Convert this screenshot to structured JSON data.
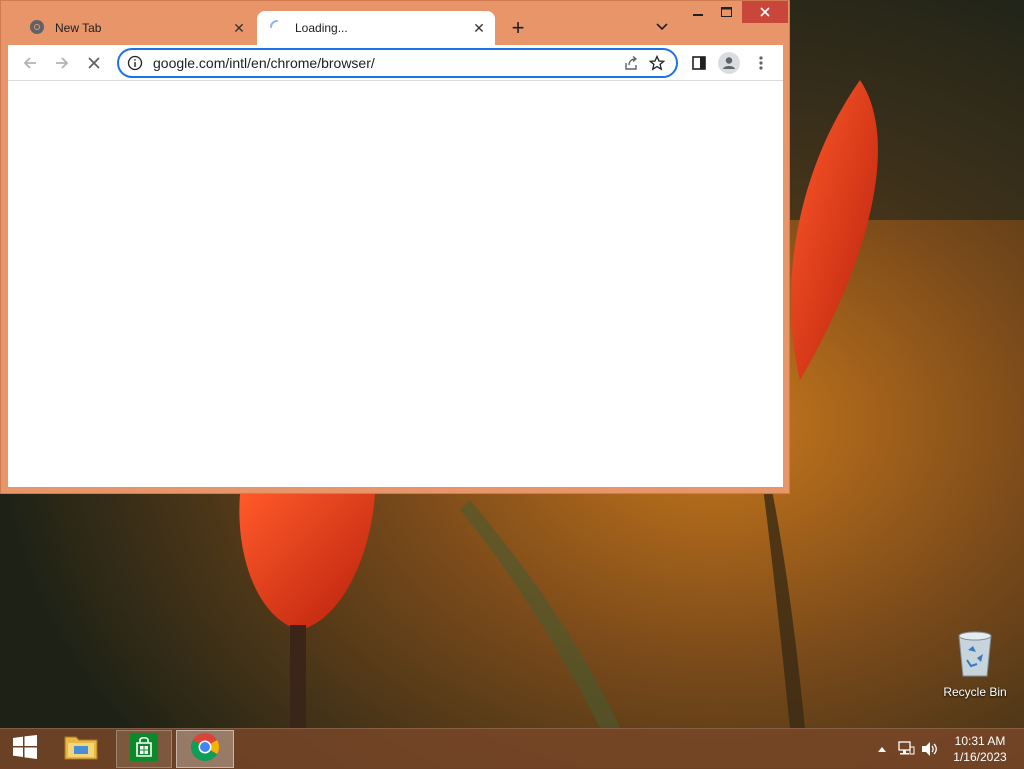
{
  "browser": {
    "tabs": [
      {
        "title": "New Tab"
      },
      {
        "title": "Loading..."
      }
    ],
    "url": "google.com/intl/en/chrome/browser/",
    "colors": {
      "frame": "#e8956a",
      "accent": "#1a73e8",
      "close_button": "#c9473a"
    }
  },
  "desktop": {
    "recycle_bin_label": "Recycle Bin"
  },
  "taskbar": {
    "time": "10:31 AM",
    "date": "1/16/2023"
  }
}
